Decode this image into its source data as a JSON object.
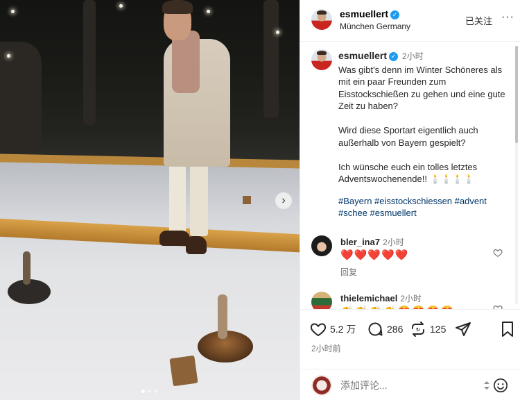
{
  "header": {
    "username": "esmuellert",
    "location": "München Germany",
    "follow_label": "已关注",
    "more_label": "···"
  },
  "caption": {
    "username": "esmuellert",
    "time": "2小时",
    "text": "Was gibt's denn im Winter Schöneres als mit ein paar Freunden zum Eisstockschießen zu gehen und eine gute Zeit zu haben?\n\nWird diese Sportart eigentlich auch außerhalb von Bayern gespielt?\n\nIch wünsche euch ein tolles letztes Adventswochenende!! 🕯️🕯️🕯️🕯️",
    "hashtags": "#Bayern #eisstockschiessen #advent #schee #esmuellert"
  },
  "comments": [
    {
      "username": "bler_ina7",
      "time": "2小时",
      "text": "❤️❤️❤️❤️❤️",
      "reply_label": "回复"
    },
    {
      "username": "thielemichael",
      "time": "2小时",
      "text": "👏👏👏👏😍😍😍😍"
    }
  ],
  "actions": {
    "likes": "5.2 万",
    "comments": "286",
    "shares": "125",
    "posted": "2小时前"
  },
  "add_comment": {
    "placeholder": "添加评论..."
  },
  "icons": {
    "verified": "verified-badge-icon",
    "heart": "heart-icon",
    "comment": "comment-bubble-icon",
    "repost": "repost-icon",
    "share": "paper-plane-icon",
    "save": "bookmark-icon",
    "emoji": "emoji-icon",
    "next": "chevron-right-icon"
  },
  "colors": {
    "verified": "#1d9bf0",
    "hashtag": "#00376b",
    "muted": "#737373"
  }
}
